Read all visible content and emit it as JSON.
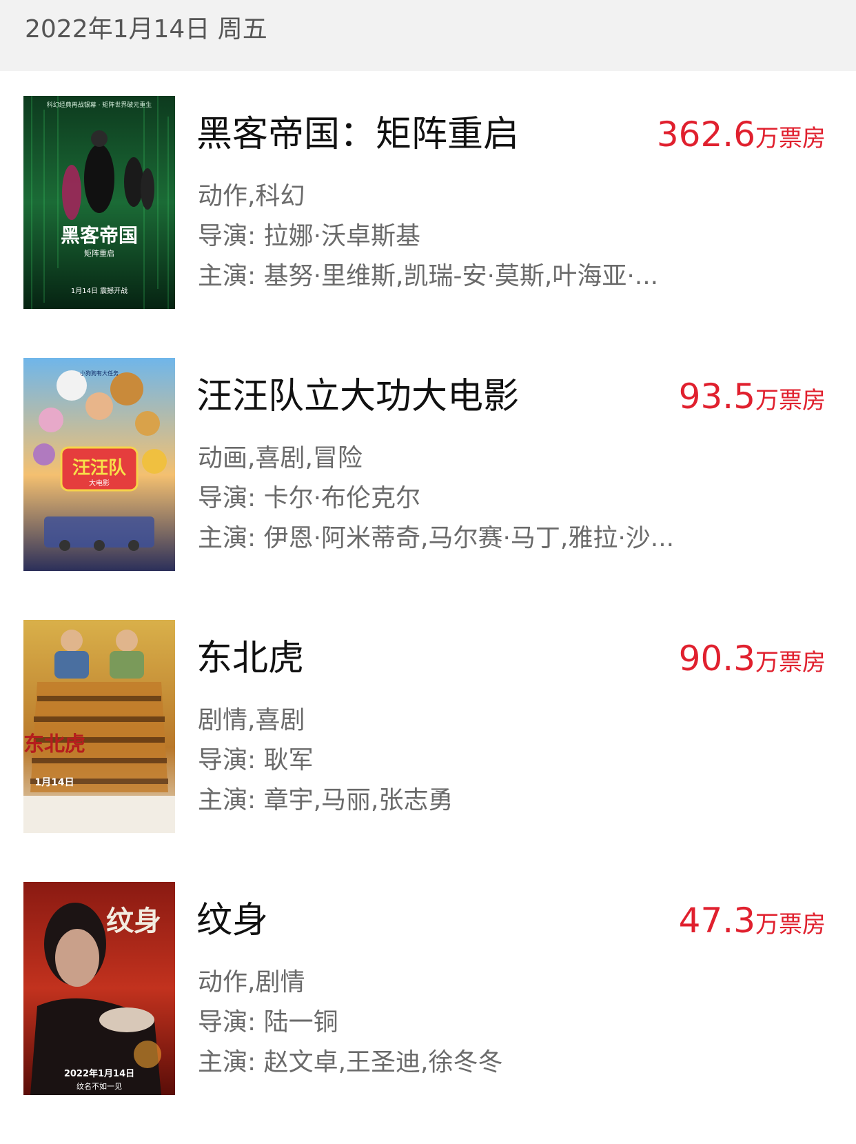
{
  "header": {
    "date": "2022年1月14日 周五"
  },
  "movies": [
    {
      "title": "黑客帝国：矩阵重启",
      "box_office": "362.6",
      "unit": "万票房",
      "genre": "动作,科幻",
      "director": "导演: 拉娜·沃卓斯基",
      "cast": "主演: 基努·里维斯,凯瑞-安·莫斯,叶海亚·...",
      "poster_text": {
        "main": "黑客帝国",
        "sub": "矩阵重启",
        "date": "1月14日 震撼开战",
        "top": "科幻经典再战银幕 · 矩阵世界破元重生"
      }
    },
    {
      "title": "汪汪队立大功大电影",
      "box_office": "93.5",
      "unit": "万票房",
      "genre": "动画,喜剧,冒险",
      "director": "导演: 卡尔·布伦克尔",
      "cast": "主演: 伊恩·阿米蒂奇,马尔赛·马丁,雅拉·沙...",
      "poster_text": {
        "main": "汪汪队",
        "sub": "大电影",
        "top": "小狗狗有大任务"
      }
    },
    {
      "title": "东北虎",
      "box_office": "90.3",
      "unit": "万票房",
      "genre": "剧情,喜剧",
      "director": "导演: 耿军",
      "cast": "主演: 章宇,马丽,张志勇",
      "poster_text": {
        "main": "东北虎",
        "date": "1月14日"
      }
    },
    {
      "title": "纹身",
      "box_office": "47.3",
      "unit": "万票房",
      "genre": "动作,剧情",
      "director": "导演: 陆一铜",
      "cast": "主演: 赵文卓,王圣迪,徐冬冬",
      "poster_text": {
        "main": "纹身",
        "date": "2022年1月14日",
        "sub": "纹名不如一见"
      }
    }
  ],
  "colors": {
    "accent": "#e0202e",
    "title": "#111111",
    "meta": "#6a6a6a",
    "header_bg": "#f2f2f2"
  }
}
